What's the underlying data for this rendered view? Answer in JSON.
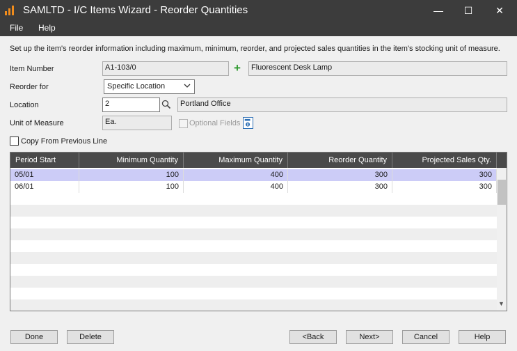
{
  "window": {
    "title": "SAMLTD - I/C Items Wizard - Reorder Quantities",
    "minimize": "—",
    "maximize": "☐",
    "close": "✕"
  },
  "menu": {
    "file": "File",
    "help": "Help"
  },
  "instructions": "Set up the item's reorder information including maximum, minimum, reorder, and projected sales quantities in the item's stocking unit of measure.",
  "form": {
    "item_number_label": "Item Number",
    "item_number_value": "A1-103/0",
    "item_description": "Fluorescent Desk Lamp",
    "reorder_for_label": "Reorder for",
    "reorder_for_value": "Specific Location",
    "location_label": "Location",
    "location_value": "2",
    "location_name": "Portland Office",
    "uom_label": "Unit of Measure",
    "uom_value": "Ea.",
    "optional_fields_label": "Optional Fields",
    "copy_label": "Copy From Previous Line"
  },
  "grid": {
    "columns": [
      "Period Start",
      "Minimum Quantity",
      "Maximum Quantity",
      "Reorder Quantity",
      "Projected Sales Qty."
    ],
    "rows": [
      [
        "05/01",
        "100",
        "400",
        "300",
        "300"
      ],
      [
        "06/01",
        "100",
        "400",
        "300",
        "300"
      ]
    ]
  },
  "buttons": {
    "done": "Done",
    "delete": "Delete",
    "back": "<Back",
    "next": "Next>",
    "cancel": "Cancel",
    "help": "Help"
  },
  "colors": {
    "titlebar": "#3c3c3c",
    "grid_header": "#4a4a4a",
    "selected_row": "#ccccf7",
    "add_icon": "#2f9a2f"
  }
}
